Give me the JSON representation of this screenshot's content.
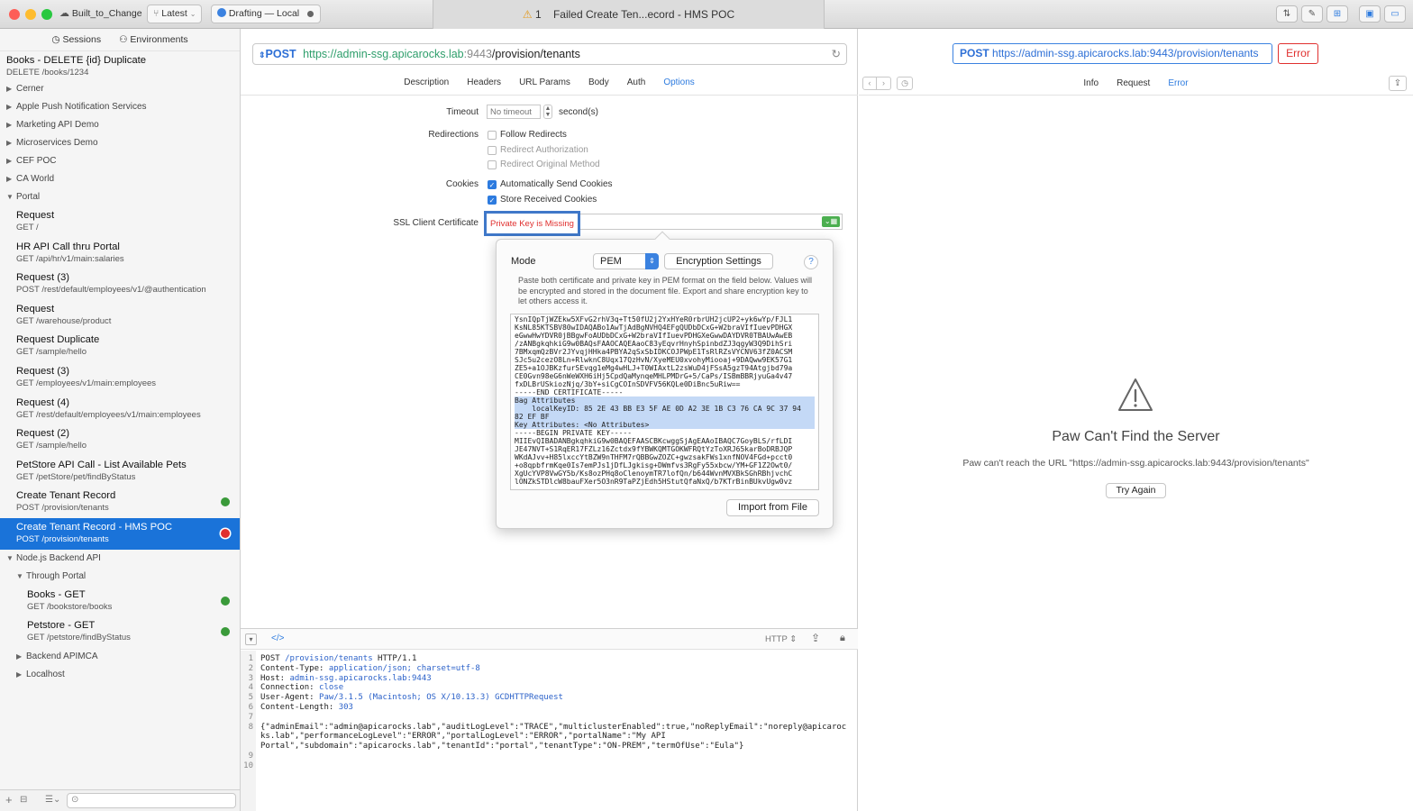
{
  "titlebar": {
    "project": "Built_to_Change",
    "version": "Latest",
    "status": "Drafting — Local",
    "warning_count": "1",
    "window_title": "Failed Create Ten...ecord - HMS POC"
  },
  "sidebar": {
    "tabs": [
      "Sessions",
      "Environments"
    ],
    "top_item": {
      "name": "Books - DELETE {id} Duplicate",
      "method_path": "DELETE /books/1234"
    },
    "groups_collapsed": [
      "Cerner",
      "Apple Push Notification Services",
      "Marketing API Demo",
      "Microservices Demo",
      "CEF POC",
      "CA World"
    ],
    "portal_group": "Portal",
    "portal_items": [
      {
        "name": "Request",
        "method_path": "GET /",
        "status": ""
      },
      {
        "name": "HR API Call thru Portal",
        "method_path": "GET /api/hr/v1/main:salaries",
        "status": ""
      },
      {
        "name": "Request (3)",
        "method_path": "POST /rest/default/employees/v1/@authentication",
        "status": ""
      },
      {
        "name": "Request",
        "method_path": "GET /warehouse/product",
        "status": ""
      },
      {
        "name": "Request Duplicate",
        "method_path": "GET /sample/hello",
        "status": ""
      },
      {
        "name": "Request (3)",
        "method_path": "GET /employees/v1/main:employees",
        "status": ""
      },
      {
        "name": "Request (4)",
        "method_path": "GET /rest/default/employees/v1/main:employees",
        "status": ""
      },
      {
        "name": "Request (2)",
        "method_path": "GET /sample/hello",
        "status": ""
      },
      {
        "name": "PetStore API Call - List Available Pets",
        "method_path": "GET /petStore/pet/findByStatus",
        "status": ""
      },
      {
        "name": "Create Tenant Record",
        "method_path": "POST /provision/tenants",
        "status": "success"
      },
      {
        "name": "Create Tenant Record - HMS POC",
        "method_path": "POST /provision/tenants",
        "status": "error"
      }
    ],
    "node_group": "Node.js Backend API",
    "through_portal": "Through Portal",
    "node_items": [
      {
        "name": "Books - GET",
        "method_path": "GET /bookstore/books",
        "status": "success"
      },
      {
        "name": "Petstore - GET",
        "method_path": "GET /petstore/findByStatus",
        "status": "success"
      }
    ],
    "bottom_groups": [
      "Backend APIMCA",
      "Localhost"
    ]
  },
  "request": {
    "method": "POST",
    "url_base": "https://admin-ssg.apicarocks.lab",
    "url_port": ":9443",
    "url_path": "/provision/tenants",
    "tabs": [
      "Description",
      "Headers",
      "URL Params",
      "Body",
      "Auth",
      "Options"
    ],
    "active_tab": "Options"
  },
  "options": {
    "timeout_label": "Timeout",
    "timeout_placeholder": "No timeout",
    "timeout_unit": "second(s)",
    "redirections_label": "Redirections",
    "follow_redirects": "Follow Redirects",
    "redirect_auth": "Redirect Authorization",
    "redirect_original": "Redirect Original Method",
    "cookies_label": "Cookies",
    "auto_send": "Automatically Send Cookies",
    "store_received": "Store Received Cookies",
    "ssl_label": "SSL Client Certificate",
    "ssl_error": "Private Key is Missing"
  },
  "popover": {
    "mode_label": "Mode",
    "mode_value": "PEM",
    "encryption_button": "Encryption Settings",
    "help": "?",
    "description": "Paste both certificate and private key in PEM format on the field below. Values will be encrypted and stored in the document file. Export and share encryption key to let others access it.",
    "pem_lines_before": [
      "YsnIQpTjWZEkw5XFvG2rhV3q+Tt50fU2j2YxHYeR0rbrUH2jcUP2+yk6wYp/FJL1",
      "KsNL85KTSBV80wIDAQABo1AwTjAdBgNVHQ4EFgQUDbDCxG+W2braVIfIuevPDHGX",
      "eGwwHwYDVR0jBBgwFoAUDbDCxG+W2braVIfIuevPDHGXeGwwDAYDVR0TBAUwAwEB",
      "/zANBgkqhkiG9w0BAQsFAAOCAQEAaoC83yEqvrHnyhSpinbdZJ3qgyW3Q9DihSri",
      "7BMxqmQzBVr2JYvqjHHka4PBYA2qSxSbIDKCOJPWpE1TsRlRZsVYCNV63fZ0ACSM",
      "SJc5u2cezO8Ln+RlwknC8Uqx17QzHvN/XyeMEU0xvohyMiooaj+9DAQww9EK57G1",
      "ZE5+a1OJBKzfurSEvqg1eMg4wHLJ+T0WIAxtL2zsWuD4jFSsA5gzT94Atgjbd79a",
      "CE0Gvn98eG6nWeWXH6iHj5CpdQaMynqeMHLPMDrG+5/CaPs/ISBmBBRjyuGa4v47",
      "fxDLBrUSkiozNjq/3bY+siCgCOInSDVFV56KQLe0DiBnc5uRiw==",
      "-----END CERTIFICATE-----"
    ],
    "pem_highlighted": [
      "Bag Attributes",
      "    localKeyID: 85 2E 43 BB E3 5F AE 0D A2 3E 1B C3 76 CA 9C 37 94",
      "82 EF BF",
      "Key Attributes: <No Attributes>"
    ],
    "pem_lines_after": [
      "-----BEGIN PRIVATE KEY-----",
      "MIIEvQIBADANBgkqhkiG9w0BAQEFAASCBKcwggSjAgEAAoIBAQC7GoyBLS/rfLDI",
      "JE47NVT+S1RqER17FZLz16Zctdx9fYBWKQMTGOKWFRQtYzToXRJ65karBoDRBJQP",
      "WKdAJvv+H85lxccYtBZW9nTHFM7rQBBGwZOZC+gwzsakFWs1xnfNOV4FGd+pcct0",
      "+o8qpbfrmKqe0Is7emPJs1jDfLJgkisg+DWmfvs3RgFy55xbcw/YM+GF1Z2Owt0/",
      "XgUcYVP8VwGY5b/Ks8ozPHq8oClenoymTR7lofQn/b644WvnMVXBkSGhRBhjvchC",
      "lONZkSTDlcW8bauFXer5O3nR9TaPZjEdh5HStutQfaNxQ/b7KTrBinBUkvUgw0vz"
    ],
    "import_button": "Import from File"
  },
  "code": {
    "format": "HTTP",
    "line_numbers": "1\n2\n3\n4\n5\n6\n7\n8\n\n\n9\n10",
    "lines": [
      {
        "a": "POST ",
        "b": "/provision/tenants",
        "c": " HTTP/1.1"
      },
      {
        "a": "Content-Type: ",
        "b": "application/json; charset=utf-8",
        "c": ""
      },
      {
        "a": "Host: ",
        "b": "admin-ssg.apicarocks.lab:9443",
        "c": ""
      },
      {
        "a": "Connection: ",
        "b": "close",
        "c": ""
      },
      {
        "a": "User-Agent: ",
        "b": "Paw/3.1.5 (Macintosh; OS X/10.13.3) GCDHTTPRequest",
        "c": ""
      },
      {
        "a": "Content-Length: ",
        "b": "303",
        "c": ""
      }
    ],
    "body": "{\"adminEmail\":\"admin@apicarocks.lab\",\"auditLogLevel\":\"TRACE\",\"multiclusterEnabled\":true,\"noReplyEmail\":\"noreply@apicaroc\nks.lab\",\"performanceLogLevel\":\"ERROR\",\"portalLogLevel\":\"ERROR\",\"portalName\":\"My API\nPortal\",\"subdomain\":\"apicarocks.lab\",\"tenantId\":\"portal\",\"tenantType\":\"ON-PREM\",\"termOfUse\":\"Eula\"}"
  },
  "response": {
    "method": "POST",
    "url": "https://admin-ssg.apicarocks.lab:9443/provision/tenants",
    "badge": "Error",
    "tabs": [
      "Info",
      "Request",
      "Error"
    ],
    "active_tab": "Error",
    "error_title": "Paw Can't Find the Server",
    "error_message": "Paw can't reach the URL \"https://admin-ssg.apicarocks.lab:9443/provision/tenants\"",
    "try_again": "Try Again"
  },
  "colors": {
    "accent": "#1a73d9",
    "error": "#e0302f",
    "success": "#3a9a3a",
    "url_green": "#2e9e6b"
  }
}
